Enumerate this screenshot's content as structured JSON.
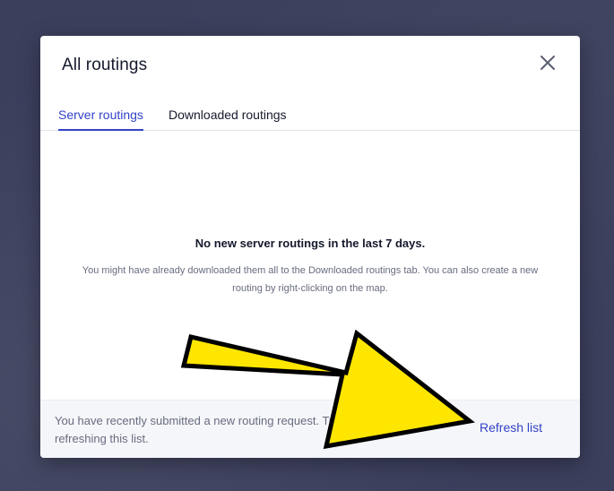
{
  "modal": {
    "title": "All routings",
    "close_icon": "close-icon"
  },
  "tabs": [
    {
      "label": "Server routings",
      "active": true
    },
    {
      "label": "Downloaded routings",
      "active": false
    }
  ],
  "empty_state": {
    "title": "No new server routings in the last 7 days.",
    "description": "You might have already downloaded them all to the Downloaded routings tab. You can also create a new routing by right-clicking on the map."
  },
  "footer": {
    "message": "You have recently submitted a new routing request. Try refreshing this list.",
    "refresh_label": "Refresh list"
  },
  "annotation": {
    "arrow_color": "#ffe600",
    "arrow_outline": "#000000"
  },
  "colors": {
    "accent": "#3343c8",
    "backdrop": "#3b3f5c"
  }
}
